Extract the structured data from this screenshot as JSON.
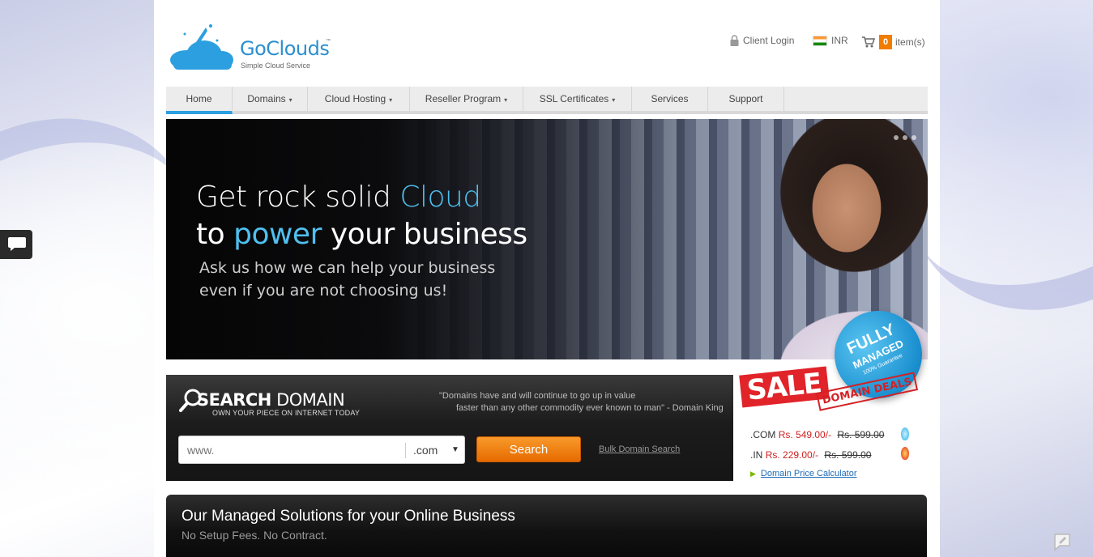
{
  "header": {
    "logo_name": "GoClouds",
    "logo_tm": "™",
    "logo_tagline": "Simple Cloud Service",
    "client_login": "Client Login",
    "currency": "INR",
    "cart_count": "0",
    "cart_label": "item(s)"
  },
  "nav": {
    "items": [
      {
        "label": "Home",
        "dropdown": false
      },
      {
        "label": "Domains",
        "dropdown": true
      },
      {
        "label": "Cloud Hosting",
        "dropdown": true
      },
      {
        "label": "Reseller Program",
        "dropdown": true
      },
      {
        "label": "SSL Certificates",
        "dropdown": true
      },
      {
        "label": "Services",
        "dropdown": false
      },
      {
        "label": "Support",
        "dropdown": false
      }
    ],
    "caret": "▾"
  },
  "hero": {
    "line1_plain": "Get rock solid ",
    "line1_highlight": "Cloud",
    "line2_plain_a": "to ",
    "line2_highlight": "power",
    "line2_plain_b": " your business",
    "sub1": "Ask us how we can help your business",
    "sub2": "even if you are not choosing us!"
  },
  "badge": {
    "line1": "FULLY",
    "line2": "MANAGED",
    "line3": "100% Guarantee",
    "color": "#1a8fcf"
  },
  "search": {
    "title_bold": "SEARCH",
    "title_rest": " DOMAIN",
    "subtitle": "OWN YOUR PIECE ON INTERNET TODAY",
    "quote_line1": "\"Domains have and will continue to go up in value",
    "quote_line2": "faster than any other commodity ever known to man\" - Domain King",
    "input_placeholder": "www.",
    "tld_selected": ".com",
    "button_label": "Search",
    "bulk_link": "Bulk Domain Search",
    "button_color": "#f07d00"
  },
  "sale": {
    "sale_label": "SALE",
    "deals_label": "DOMAIN DEALS",
    "com_tld": ".COM",
    "com_price": "Rs. 549.00/-",
    "com_old": "Rs. 599.00",
    "in_tld": ".IN",
    "in_price": "Rs. 229.00/-",
    "in_old": "Rs. 599.00",
    "calculator_link": "Domain Price Calculator",
    "accent": "#e1232a"
  },
  "managed": {
    "title": "Our Managed Solutions for your Online Business",
    "subtitle": "No Setup Fees. No Contract."
  },
  "icons": {
    "chat": "chat-bubble-icon",
    "lock": "lock-icon",
    "cart": "cart-icon",
    "flag": "india-flag-icon"
  }
}
